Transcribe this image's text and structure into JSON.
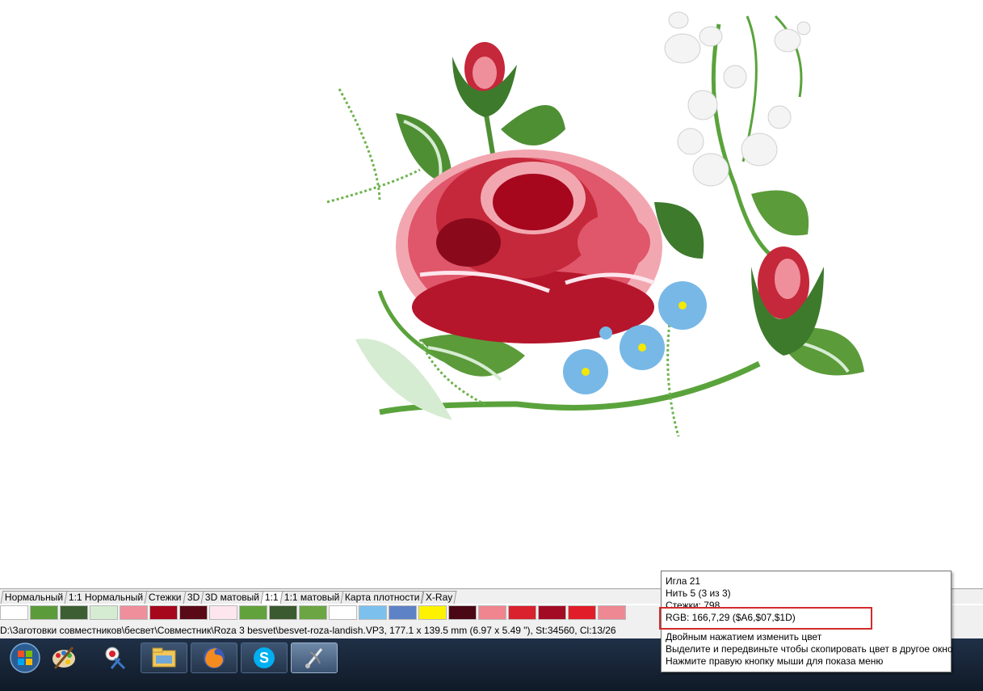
{
  "view_tabs": [
    "Нормальный",
    "1:1 Нормальный",
    "Стежки",
    "3D",
    "3D матовый",
    "1:1",
    "1:1 матовый",
    "Карта плотности",
    "X-Ray"
  ],
  "active_tab_index": 5,
  "palette": [
    "#ffffff",
    "#5b9b3a",
    "#3d5e32",
    "#d6ecd2",
    "#ef8f9c",
    "#a6071d",
    "#5a0a16",
    "#fde6ee",
    "#62a23d",
    "#3c5a2f",
    "#6ca544",
    "#ffffff",
    "#7cc1ee",
    "#5e82c6",
    "#fff200",
    "#4a0814",
    "#f0848f",
    "#d9222d",
    "#a30b24",
    "#e01d28",
    "#ee8892"
  ],
  "status_path": "D:\\Заготовки совместников\\бесвет\\Совместник\\Roza 3 besvet\\besvet-roza-landish.VP3, 177.1 x 139.5 mm (6.97 x 5.49 \"), St:34560, Cl:13/26",
  "tooltip": {
    "needle": "Игла 21",
    "thread": "Нить 5 (3 из 3)",
    "stitches": "Стежки: 798",
    "rgb": "RGB: 166,7,29 ($A6,$07,$1D)",
    "hint_1": "Двойным нажатием изменить цвет",
    "hint_2": "Выделите и передвиньте чтобы скопировать цвет в другое окно",
    "hint_3": "Нажмите правую кнопку мыши для показа меню"
  },
  "taskbar_items": [
    "start-orb-icon",
    "paint-palette-icon",
    "embroidery-scissors-icon",
    "file-explorer-icon",
    "firefox-icon",
    "skype-icon",
    "embroidery-app-icon"
  ],
  "colors": {
    "highlight": "#d42a2a",
    "stem": "#5aa33c",
    "rose": "#c5283a"
  }
}
